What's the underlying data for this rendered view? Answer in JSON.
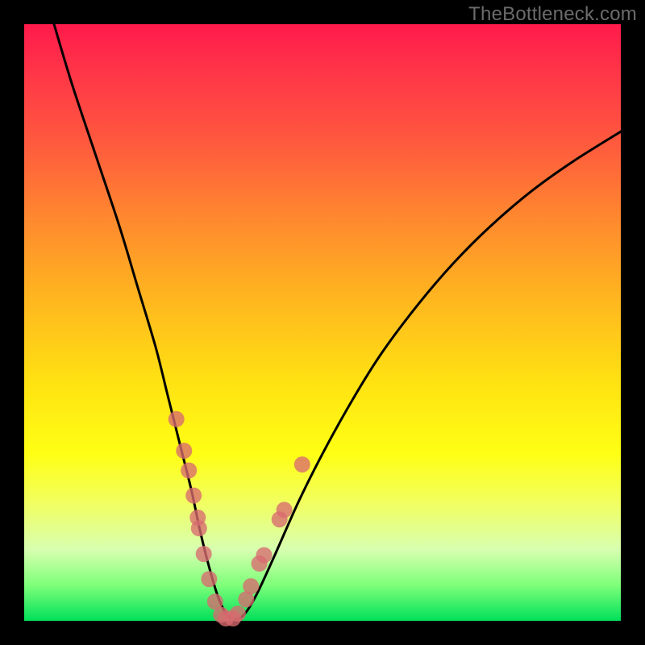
{
  "watermark": "TheBottleneck.com",
  "chart_data": {
    "type": "line",
    "title": "",
    "xlabel": "",
    "ylabel": "",
    "xlim": [
      0,
      100
    ],
    "ylim": [
      0,
      100
    ],
    "grid": false,
    "series": [
      {
        "name": "curve",
        "color": "#000000",
        "x": [
          5,
          8,
          12,
          16,
          19,
          22,
          24,
          26,
          28,
          29.5,
          31,
          32.5,
          34,
          35.5,
          37,
          39,
          42,
          46,
          50,
          55,
          60,
          66,
          72,
          78,
          85,
          92,
          100
        ],
        "y": [
          100,
          90,
          78,
          66,
          56,
          46,
          38,
          30,
          22,
          15,
          9,
          4,
          1,
          0.3,
          1.2,
          4.5,
          11,
          20,
          28,
          37,
          45,
          53,
          60,
          66,
          72,
          77,
          82
        ]
      },
      {
        "name": "dots",
        "color": "#d96a6f",
        "x": [
          25.5,
          26.8,
          27.6,
          28.4,
          29.1,
          29.3,
          30.1,
          31.0,
          32.0,
          33.0,
          33.8,
          35.0,
          35.8,
          37.2,
          38.0,
          39.4,
          40.2,
          42.8,
          43.6,
          46.6
        ],
        "y": [
          33.8,
          28.5,
          25.2,
          21.0,
          17.3,
          15.5,
          11.2,
          7.0,
          3.2,
          1.0,
          0.4,
          0.4,
          1.2,
          3.6,
          5.8,
          9.6,
          11.0,
          17.0,
          18.6,
          26.2
        ]
      }
    ]
  }
}
